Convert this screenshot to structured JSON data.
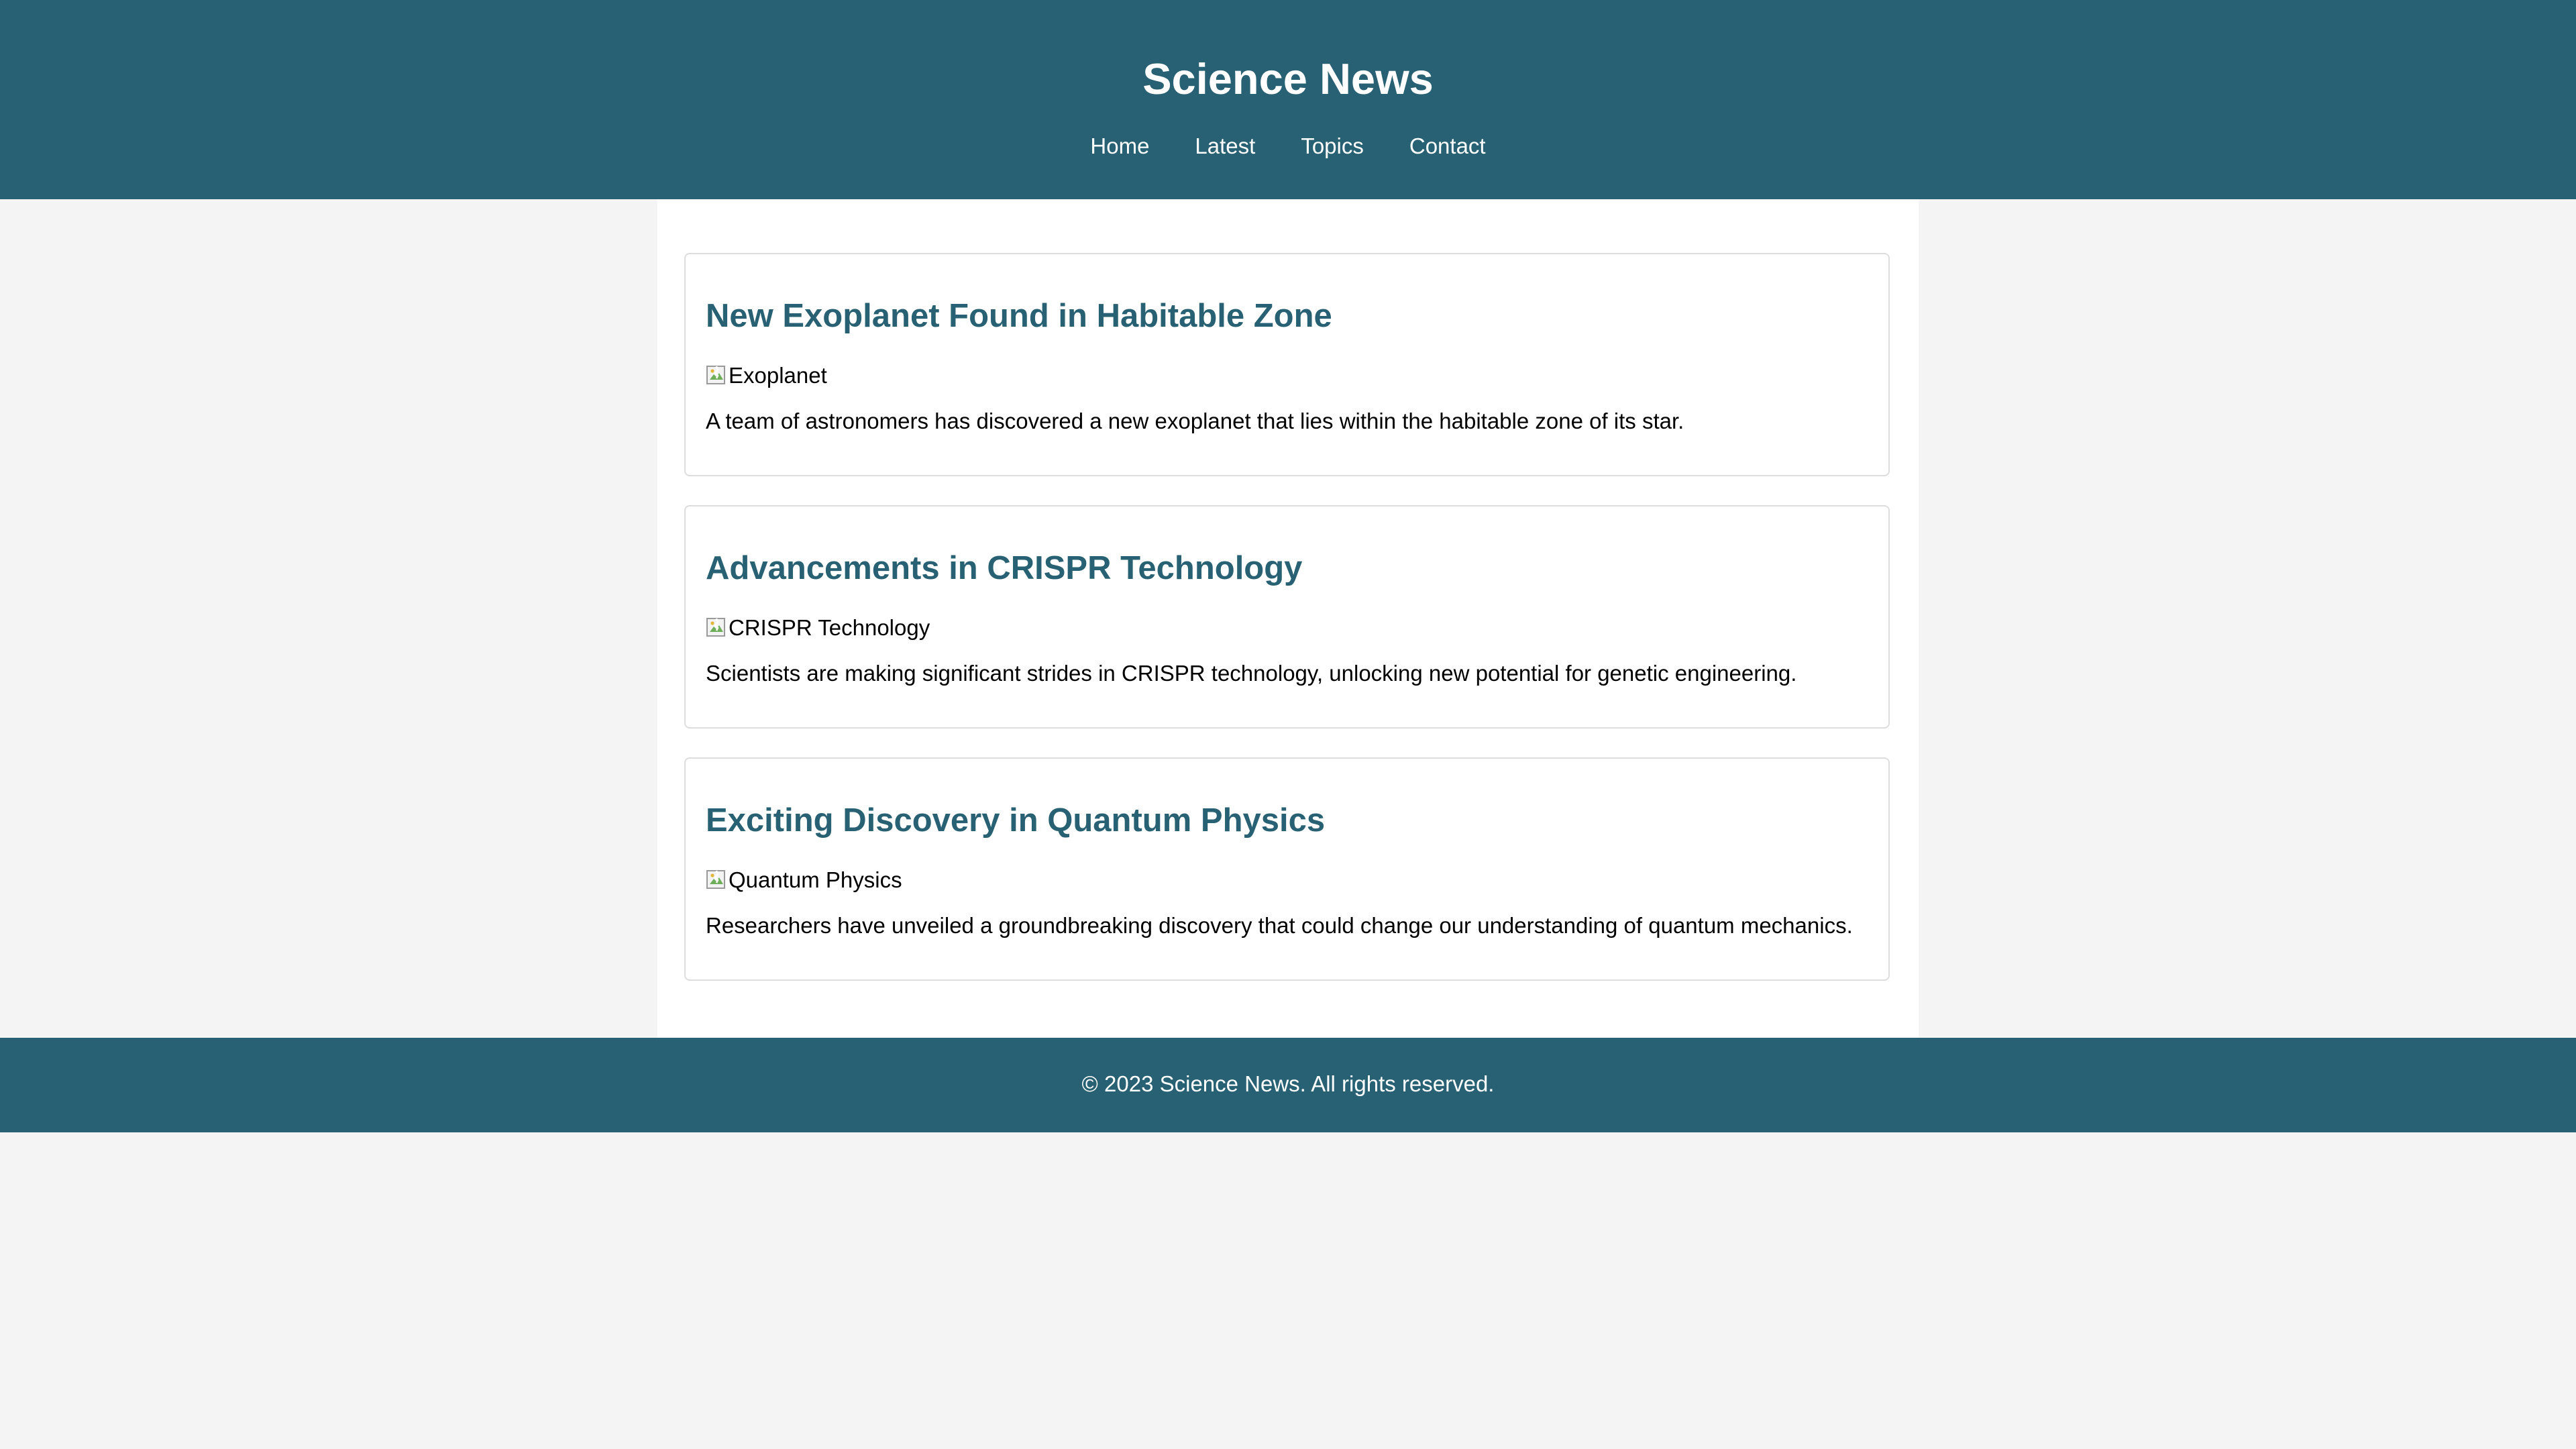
{
  "header": {
    "title": "Science News",
    "nav": [
      {
        "label": "Home"
      },
      {
        "label": "Latest"
      },
      {
        "label": "Topics"
      },
      {
        "label": "Contact"
      }
    ]
  },
  "articles": [
    {
      "title": "New Exoplanet Found in Habitable Zone",
      "image_alt": "Exoplanet",
      "summary": "A team of astronomers has discovered a new exoplanet that lies within the habitable zone of its star."
    },
    {
      "title": "Advancements in CRISPR Technology",
      "image_alt": "CRISPR Technology",
      "summary": "Scientists are making significant strides in CRISPR technology, unlocking new potential for genetic engineering."
    },
    {
      "title": "Exciting Discovery in Quantum Physics",
      "image_alt": "Quantum Physics",
      "summary": "Researchers have unveiled a groundbreaking discovery that could change our understanding of quantum mechanics."
    }
  ],
  "footer": {
    "text": "© 2023 Science News. All rights reserved."
  },
  "colors": {
    "brand": "#286173",
    "page_background": "#f4f4f4",
    "content_background": "#ffffff",
    "card_border": "#dddddd",
    "header_text": "#ffffff"
  },
  "icons": {
    "broken_image": "broken-image-icon"
  }
}
